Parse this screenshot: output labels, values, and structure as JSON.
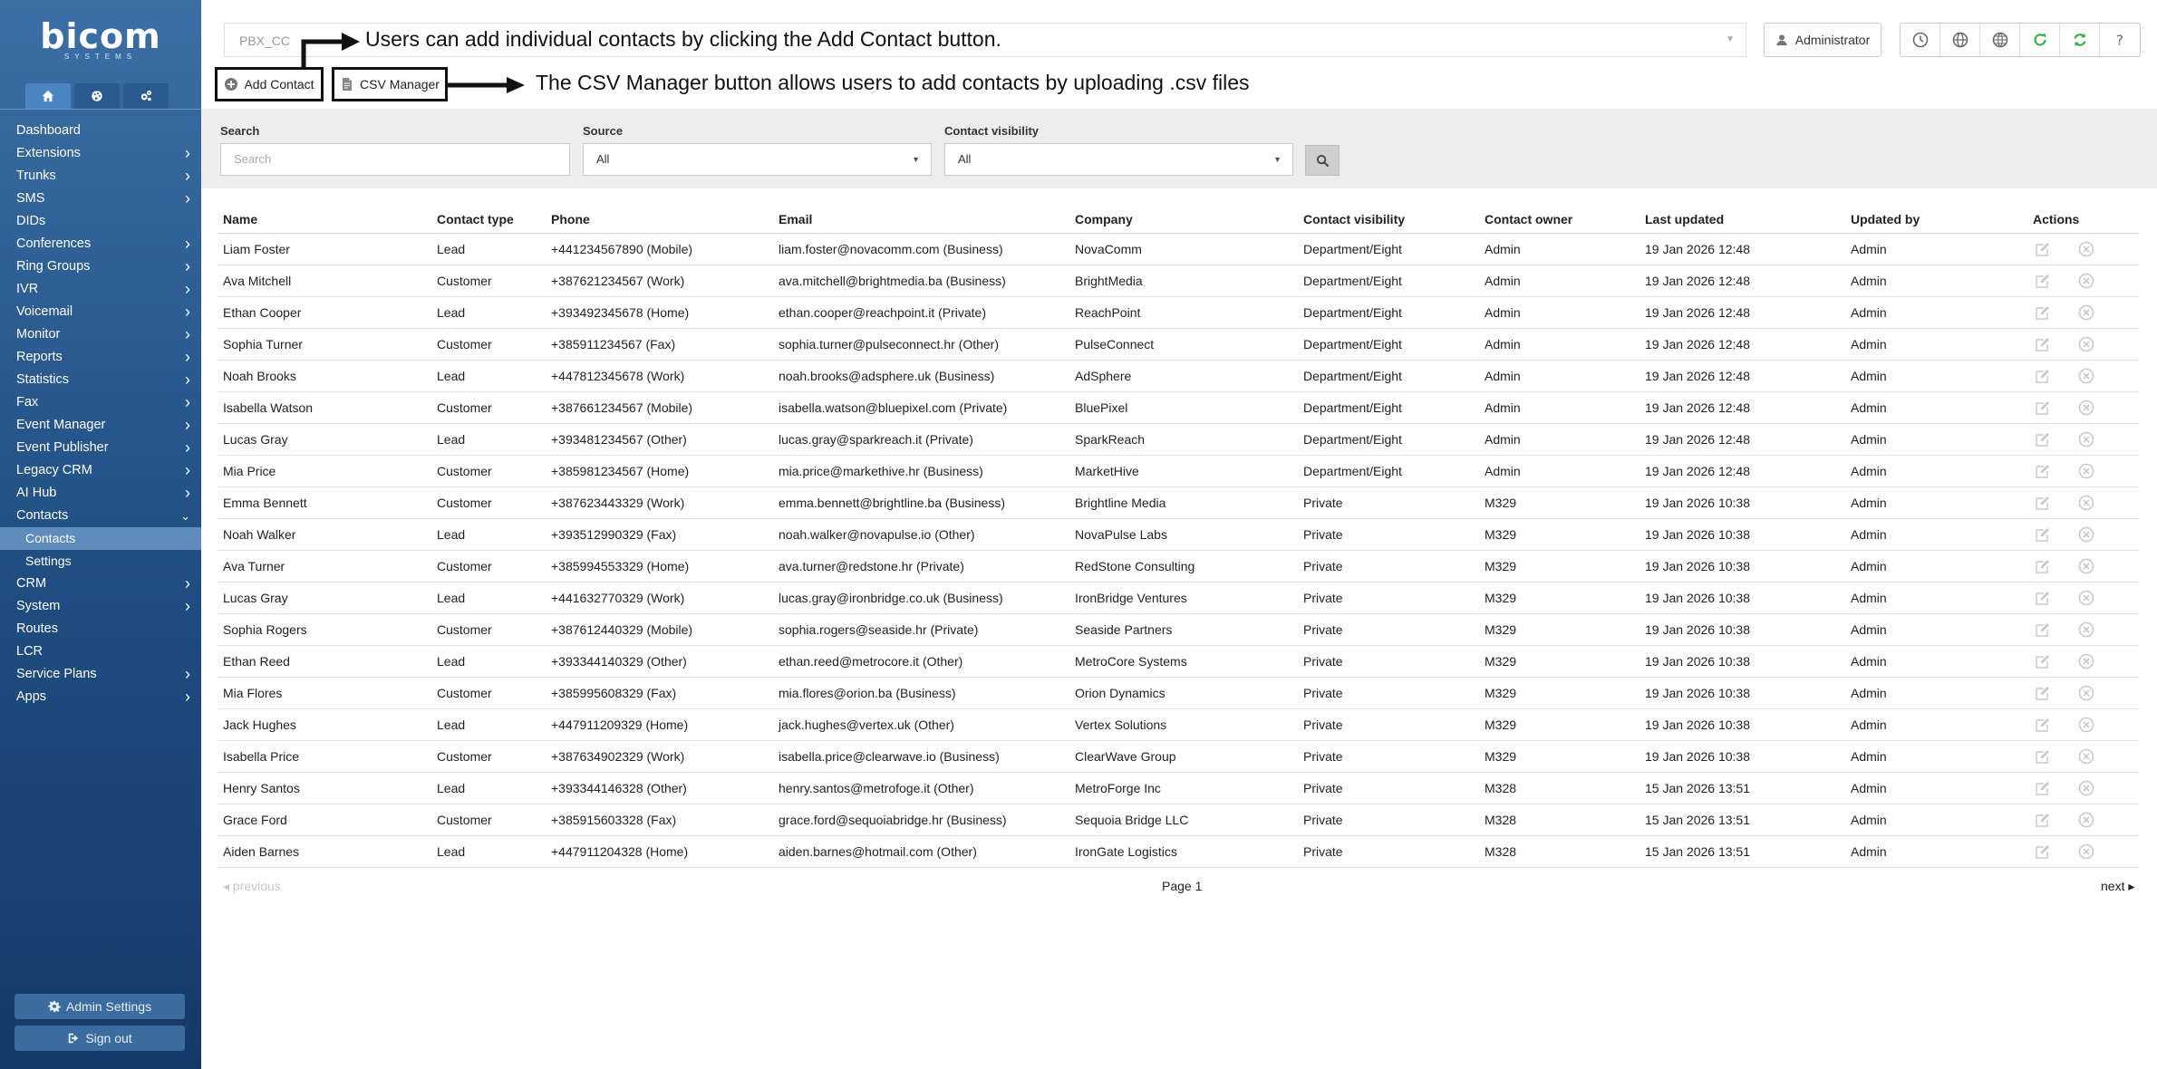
{
  "sidebar": {
    "logo": "bicom",
    "logo_sub": "SYSTEMS",
    "tabs": [
      {
        "icon": "home-icon"
      },
      {
        "icon": "palette-icon"
      },
      {
        "icon": "cogs-icon"
      }
    ],
    "items": [
      {
        "label": "Dashboard",
        "chevron": false
      },
      {
        "label": "Extensions",
        "chevron": true
      },
      {
        "label": "Trunks",
        "chevron": true
      },
      {
        "label": "SMS",
        "chevron": true
      },
      {
        "label": "DIDs",
        "chevron": false
      },
      {
        "label": "Conferences",
        "chevron": true
      },
      {
        "label": "Ring Groups",
        "chevron": true
      },
      {
        "label": "IVR",
        "chevron": true
      },
      {
        "label": "Voicemail",
        "chevron": true
      },
      {
        "label": "Monitor",
        "chevron": true
      },
      {
        "label": "Reports",
        "chevron": true
      },
      {
        "label": "Statistics",
        "chevron": true
      },
      {
        "label": "Fax",
        "chevron": true
      },
      {
        "label": "Event Manager",
        "chevron": true
      },
      {
        "label": "Event Publisher",
        "chevron": true
      },
      {
        "label": "Legacy CRM",
        "chevron": true
      },
      {
        "label": "AI Hub",
        "chevron": true
      },
      {
        "label": "Contacts",
        "chevron": "open"
      },
      {
        "label": "Contacts",
        "sub": true,
        "active": true
      },
      {
        "label": "Settings",
        "sub": true
      },
      {
        "label": "CRM",
        "chevron": true
      },
      {
        "label": "System",
        "chevron": true
      },
      {
        "label": "Routes",
        "chevron": false
      },
      {
        "label": "LCR",
        "chevron": false
      },
      {
        "label": "Service Plans",
        "chevron": true
      },
      {
        "label": "Apps",
        "chevron": true
      }
    ],
    "admin_settings": "Admin Settings",
    "sign_out": "Sign out"
  },
  "header": {
    "pbx_value": "PBX_CC",
    "user": "Administrator"
  },
  "toolbar": {
    "add_contact": "Add Contact",
    "csv_manager": "CSV Manager"
  },
  "annotations": {
    "add_note": "Users can add individual contacts by clicking the Add Contact button.",
    "csv_note": "The CSV Manager button allows users to add contacts by uploading .csv files"
  },
  "filters": {
    "search_label": "Search",
    "search_placeholder": "Search",
    "source_label": "Source",
    "source_value": "All",
    "visibility_label": "Contact visibility",
    "visibility_value": "All"
  },
  "table": {
    "columns": [
      "Name",
      "Contact type",
      "Phone",
      "Email",
      "Company",
      "Contact visibility",
      "Contact owner",
      "Last updated",
      "Updated by",
      "Actions"
    ],
    "rows": [
      [
        "Liam Foster",
        "Lead",
        "+441234567890 (Mobile)",
        "liam.foster@novacomm.com (Business)",
        "NovaComm",
        "Department/Eight",
        "Admin",
        "19 Jan 2026 12:48",
        "Admin"
      ],
      [
        "Ava Mitchell",
        "Customer",
        "+387621234567 (Work)",
        "ava.mitchell@brightmedia.ba (Business)",
        "BrightMedia",
        "Department/Eight",
        "Admin",
        "19 Jan 2026 12:48",
        "Admin"
      ],
      [
        "Ethan Cooper",
        "Lead",
        "+393492345678 (Home)",
        "ethan.cooper@reachpoint.it (Private)",
        "ReachPoint",
        "Department/Eight",
        "Admin",
        "19 Jan 2026 12:48",
        "Admin"
      ],
      [
        "Sophia Turner",
        "Customer",
        "+385911234567 (Fax)",
        "sophia.turner@pulseconnect.hr (Other)",
        "PulseConnect",
        "Department/Eight",
        "Admin",
        "19 Jan 2026 12:48",
        "Admin"
      ],
      [
        "Noah Brooks",
        "Lead",
        "+447812345678 (Work)",
        "noah.brooks@adsphere.uk (Business)",
        "AdSphere",
        "Department/Eight",
        "Admin",
        "19 Jan 2026 12:48",
        "Admin"
      ],
      [
        "Isabella Watson",
        "Customer",
        "+387661234567 (Mobile)",
        "isabella.watson@bluepixel.com (Private)",
        "BluePixel",
        "Department/Eight",
        "Admin",
        "19 Jan 2026 12:48",
        "Admin"
      ],
      [
        "Lucas Gray",
        "Lead",
        "+393481234567 (Other)",
        "lucas.gray@sparkreach.it (Private)",
        "SparkReach",
        "Department/Eight",
        "Admin",
        "19 Jan 2026 12:48",
        "Admin"
      ],
      [
        "Mia Price",
        "Customer",
        "+385981234567 (Home)",
        "mia.price@markethive.hr (Business)",
        "MarketHive",
        "Department/Eight",
        "Admin",
        "19 Jan 2026 12:48",
        "Admin"
      ],
      [
        "Emma Bennett",
        "Customer",
        "+387623443329 (Work)",
        "emma.bennett@brightline.ba (Business)",
        "Brightline Media",
        "Private",
        "M329",
        "19 Jan 2026 10:38",
        "Admin"
      ],
      [
        "Noah Walker",
        "Lead",
        "+393512990329 (Fax)",
        "noah.walker@novapulse.io (Other)",
        "NovaPulse Labs",
        "Private",
        "M329",
        "19 Jan 2026 10:38",
        "Admin"
      ],
      [
        "Ava Turner",
        "Customer",
        "+385994553329 (Home)",
        "ava.turner@redstone.hr (Private)",
        "RedStone Consulting",
        "Private",
        "M329",
        "19 Jan 2026 10:38",
        "Admin"
      ],
      [
        "Lucas Gray",
        "Lead",
        "+441632770329 (Work)",
        "lucas.gray@ironbridge.co.uk (Business)",
        "IronBridge Ventures",
        "Private",
        "M329",
        "19 Jan 2026 10:38",
        "Admin"
      ],
      [
        "Sophia Rogers",
        "Customer",
        "+387612440329 (Mobile)",
        "sophia.rogers@seaside.hr (Private)",
        "Seaside Partners",
        "Private",
        "M329",
        "19 Jan 2026 10:38",
        "Admin"
      ],
      [
        "Ethan Reed",
        "Lead",
        "+393344140329 (Other)",
        "ethan.reed@metrocore.it (Other)",
        "MetroCore Systems",
        "Private",
        "M329",
        "19 Jan 2026 10:38",
        "Admin"
      ],
      [
        "Mia Flores",
        "Customer",
        "+385995608329 (Fax)",
        "mia.flores@orion.ba (Business)",
        "Orion Dynamics",
        "Private",
        "M329",
        "19 Jan 2026 10:38",
        "Admin"
      ],
      [
        "Jack Hughes",
        "Lead",
        "+447911209329 (Home)",
        "jack.hughes@vertex.uk (Other)",
        "Vertex Solutions",
        "Private",
        "M329",
        "19 Jan 2026 10:38",
        "Admin"
      ],
      [
        "Isabella Price",
        "Customer",
        "+387634902329 (Work)",
        "isabella.price@clearwave.io (Business)",
        "ClearWave Group",
        "Private",
        "M329",
        "19 Jan 2026 10:38",
        "Admin"
      ],
      [
        "Henry Santos",
        "Lead",
        "+393344146328 (Other)",
        "henry.santos@metrofoge.it (Other)",
        "MetroForge Inc",
        "Private",
        "M328",
        "15 Jan 2026 13:51",
        "Admin"
      ],
      [
        "Grace Ford",
        "Customer",
        "+385915603328 (Fax)",
        "grace.ford@sequoiabridge.hr (Business)",
        "Sequoia Bridge LLC",
        "Private",
        "M328",
        "15 Jan 2026 13:51",
        "Admin"
      ],
      [
        "Aiden Barnes",
        "Lead",
        "+447911204328 (Home)",
        "aiden.barnes@hotmail.com (Other)",
        "IronGate Logistics",
        "Private",
        "M328",
        "15 Jan 2026 13:51",
        "Admin"
      ]
    ]
  },
  "pagination": {
    "previous": "previous",
    "page": "Page 1",
    "next": "next"
  },
  "colors": {
    "sidebar_top": "#3c6fa5",
    "sidebar_bottom": "#163a68",
    "refresh_green": "#2eaa3a"
  }
}
